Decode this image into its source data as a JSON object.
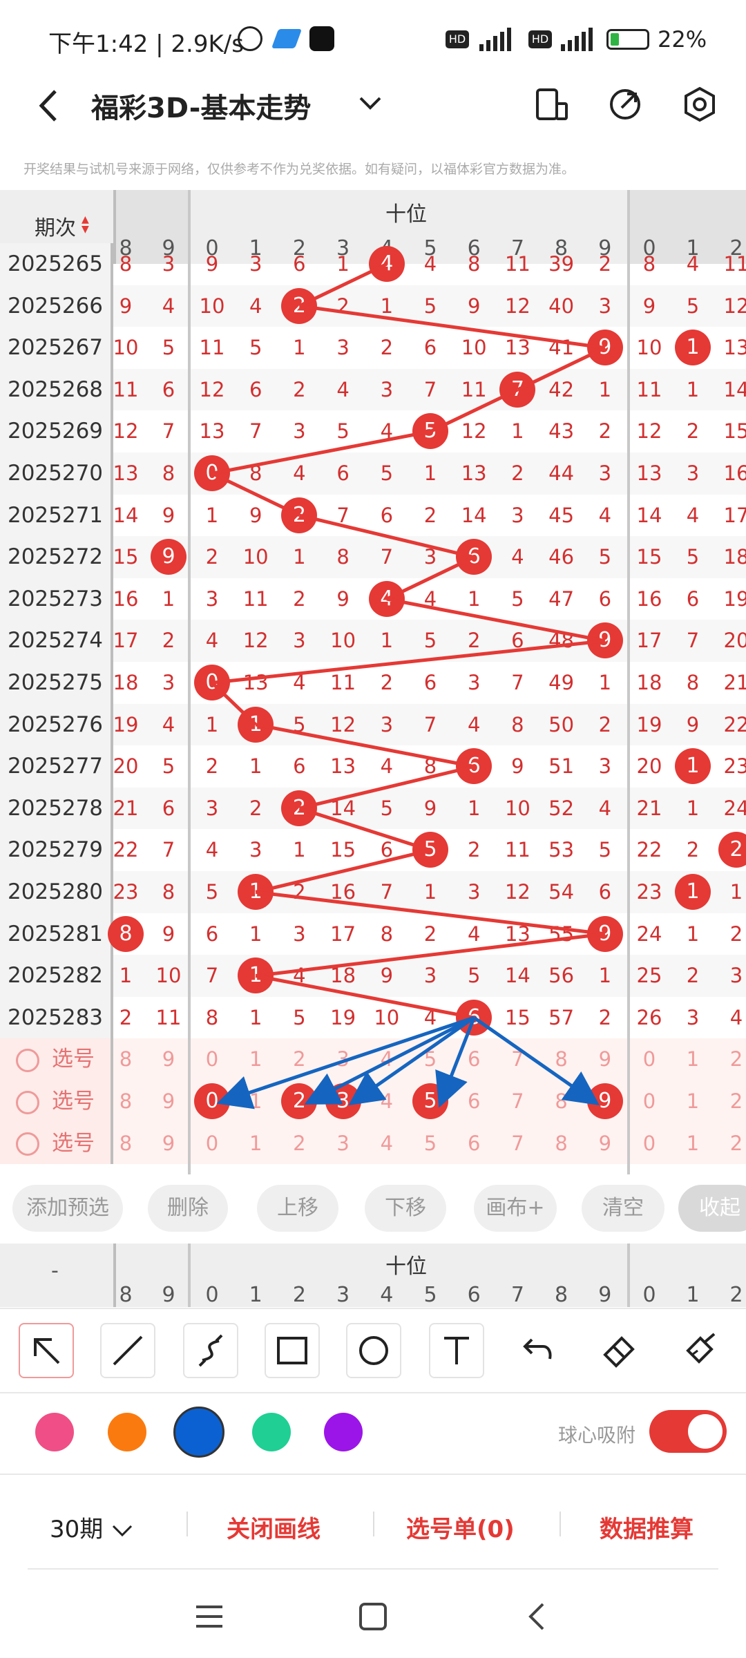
{
  "status": {
    "time": "下午1:42 | 2.9K/s",
    "battery": "22%"
  },
  "header": {
    "title": "福彩3D-基本走势",
    "disclaimer": "开奖结果与试机号来源于网络，仅供参考不作为兑奖依据。如有疑问，以福体彩官方数据为准。"
  },
  "table": {
    "period_header": "期次",
    "group_label": "十位",
    "left_cols": [
      "8",
      "9"
    ],
    "main_cols": [
      "0",
      "1",
      "2",
      "3",
      "4",
      "5",
      "6",
      "7",
      "8",
      "9"
    ],
    "right_cols": [
      "0",
      "1",
      "2"
    ],
    "rows": [
      {
        "period": "2025265",
        "l": [
          "8",
          "3"
        ],
        "m": [
          "9",
          "3",
          "6",
          "1",
          "4",
          "4",
          "8",
          "11",
          "39",
          "2"
        ],
        "r": [
          "8",
          "4",
          "11"
        ],
        "hit": 4
      },
      {
        "period": "2025266",
        "l": [
          "9",
          "4"
        ],
        "m": [
          "10",
          "4",
          "2",
          "2",
          "1",
          "5",
          "9",
          "12",
          "40",
          "3"
        ],
        "r": [
          "9",
          "5",
          "12"
        ],
        "hit": 2
      },
      {
        "period": "2025267",
        "l": [
          "10",
          "5"
        ],
        "m": [
          "11",
          "5",
          "1",
          "3",
          "2",
          "6",
          "10",
          "13",
          "41",
          "9"
        ],
        "r": [
          "10",
          "1",
          "13"
        ],
        "hit": 9,
        "rhit": 1
      },
      {
        "period": "2025268",
        "l": [
          "11",
          "6"
        ],
        "m": [
          "12",
          "6",
          "2",
          "4",
          "3",
          "7",
          "11",
          "7",
          "42",
          "1"
        ],
        "r": [
          "11",
          "1",
          "14"
        ],
        "hit": 7
      },
      {
        "period": "2025269",
        "l": [
          "12",
          "7"
        ],
        "m": [
          "13",
          "7",
          "3",
          "5",
          "4",
          "5",
          "12",
          "1",
          "43",
          "2"
        ],
        "r": [
          "12",
          "2",
          "15"
        ],
        "hit": 5
      },
      {
        "period": "2025270",
        "l": [
          "13",
          "8"
        ],
        "m": [
          "0",
          "8",
          "4",
          "6",
          "5",
          "1",
          "13",
          "2",
          "44",
          "3"
        ],
        "r": [
          "13",
          "3",
          "16"
        ],
        "hit": 0
      },
      {
        "period": "2025271",
        "l": [
          "14",
          "9"
        ],
        "m": [
          "1",
          "9",
          "2",
          "7",
          "6",
          "2",
          "14",
          "3",
          "45",
          "4"
        ],
        "r": [
          "14",
          "4",
          "17"
        ],
        "hit": 2
      },
      {
        "period": "2025272",
        "l": [
          "15",
          "9"
        ],
        "m": [
          "2",
          "10",
          "1",
          "8",
          "7",
          "3",
          "6",
          "4",
          "46",
          "5"
        ],
        "r": [
          "15",
          "5",
          "18"
        ],
        "hit": 6,
        "lhit": 1
      },
      {
        "period": "2025273",
        "l": [
          "16",
          "1"
        ],
        "m": [
          "3",
          "11",
          "2",
          "9",
          "4",
          "4",
          "1",
          "5",
          "47",
          "6"
        ],
        "r": [
          "16",
          "6",
          "19"
        ],
        "hit": 4
      },
      {
        "period": "2025274",
        "l": [
          "17",
          "2"
        ],
        "m": [
          "4",
          "12",
          "3",
          "10",
          "1",
          "5",
          "2",
          "6",
          "48",
          "9"
        ],
        "r": [
          "17",
          "7",
          "20"
        ],
        "hit": 9
      },
      {
        "period": "2025275",
        "l": [
          "18",
          "3"
        ],
        "m": [
          "0",
          "13",
          "4",
          "11",
          "2",
          "6",
          "3",
          "7",
          "49",
          "1"
        ],
        "r": [
          "18",
          "8",
          "21"
        ],
        "hit": 0
      },
      {
        "period": "2025276",
        "l": [
          "19",
          "4"
        ],
        "m": [
          "1",
          "1",
          "5",
          "12",
          "3",
          "7",
          "4",
          "8",
          "50",
          "2"
        ],
        "r": [
          "19",
          "9",
          "22"
        ],
        "hit": 1
      },
      {
        "period": "2025277",
        "l": [
          "20",
          "5"
        ],
        "m": [
          "2",
          "1",
          "6",
          "13",
          "4",
          "8",
          "6",
          "9",
          "51",
          "3"
        ],
        "r": [
          "20",
          "1",
          "23"
        ],
        "hit": 6,
        "rhit": 1
      },
      {
        "period": "2025278",
        "l": [
          "21",
          "6"
        ],
        "m": [
          "3",
          "2",
          "2",
          "14",
          "5",
          "9",
          "1",
          "10",
          "52",
          "4"
        ],
        "r": [
          "21",
          "1",
          "24"
        ],
        "hit": 2
      },
      {
        "period": "2025279",
        "l": [
          "22",
          "7"
        ],
        "m": [
          "4",
          "3",
          "1",
          "15",
          "6",
          "5",
          "2",
          "11",
          "53",
          "5"
        ],
        "r": [
          "22",
          "2",
          "2"
        ],
        "hit": 5,
        "rhit": 2
      },
      {
        "period": "2025280",
        "l": [
          "23",
          "8"
        ],
        "m": [
          "5",
          "1",
          "2",
          "16",
          "7",
          "1",
          "3",
          "12",
          "54",
          "6"
        ],
        "r": [
          "23",
          "1",
          "1"
        ],
        "hit": 1,
        "rhit": 1
      },
      {
        "period": "2025281",
        "l": [
          "8",
          "9"
        ],
        "m": [
          "6",
          "1",
          "3",
          "17",
          "8",
          "2",
          "4",
          "13",
          "55",
          "9"
        ],
        "r": [
          "24",
          "1",
          "2"
        ],
        "hit": 9,
        "lhit": 0
      },
      {
        "period": "2025282",
        "l": [
          "1",
          "10"
        ],
        "m": [
          "7",
          "1",
          "4",
          "18",
          "9",
          "3",
          "5",
          "14",
          "56",
          "1"
        ],
        "r": [
          "25",
          "2",
          "3"
        ],
        "hit": 1
      },
      {
        "period": "2025283",
        "l": [
          "2",
          "11"
        ],
        "m": [
          "8",
          "1",
          "5",
          "19",
          "10",
          "4",
          "6",
          "15",
          "57",
          "2"
        ],
        "r": [
          "26",
          "3",
          "4"
        ],
        "hit": 6
      }
    ],
    "select_rows": [
      {
        "label": "选号",
        "picked": []
      },
      {
        "label": "选号",
        "picked": [
          0,
          2,
          3,
          5,
          9
        ]
      },
      {
        "label": "选号",
        "picked": []
      }
    ]
  },
  "actions": [
    "添加预选",
    "删除",
    "上移",
    "下移",
    "画布+",
    "清空",
    "收起"
  ],
  "lower_header": {
    "dash": "-"
  },
  "tools": [
    "select-arrow",
    "line",
    "curve",
    "rectangle",
    "circle",
    "text",
    "undo",
    "eraser",
    "clear-brush"
  ],
  "colors": [
    "#ef4f86",
    "#fb7a0f",
    "#0b61d1",
    "#1fcf94",
    "#9b15e8"
  ],
  "snap_label": "球心吸附",
  "bottom": {
    "period_select": "30期",
    "close_lines": "关闭画线",
    "selection_list": "选号单(0)",
    "data_calc": "数据推算"
  }
}
